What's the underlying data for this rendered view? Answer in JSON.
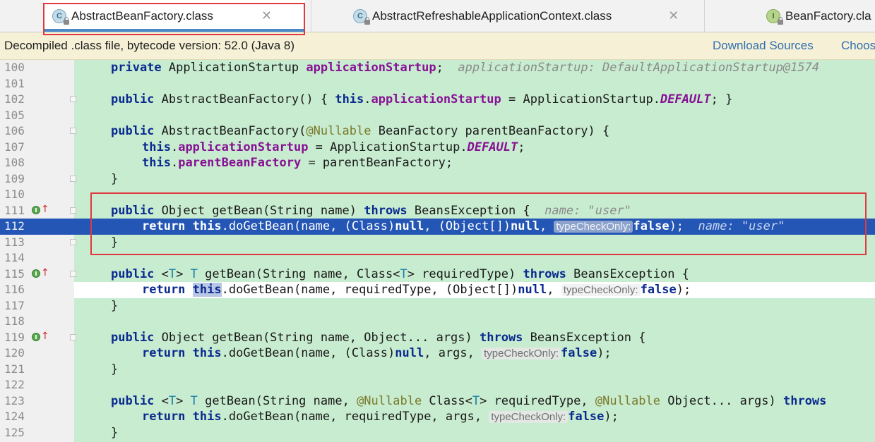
{
  "tabs": [
    {
      "icon": "C",
      "label": "AbstractBeanFactory.class",
      "close": "✕"
    },
    {
      "icon": "C",
      "label": "AbstractRefreshableApplicationContext.class",
      "close": "✕"
    },
    {
      "icon": "I",
      "label": "BeanFactory.cla"
    }
  ],
  "banner": {
    "text": "Decompiled .class file, bytecode version: 52.0 (Java 8)",
    "download_sources": "Download Sources",
    "choose": "Choos"
  },
  "lines": {
    "l100": "100",
    "l101": "101",
    "l102": "102",
    "l105": "105",
    "l106": "106",
    "l107": "107",
    "l108": "108",
    "l109": "109",
    "l110": "110",
    "l111": "111",
    "l112": "112",
    "l113": "113",
    "l114": "114",
    "l115": "115",
    "l116": "116",
    "l117": "117",
    "l118": "118",
    "l119": "119",
    "l120": "120",
    "l121": "121",
    "l122": "122",
    "l123": "123",
    "l124": "124",
    "l125": "125"
  },
  "code": {
    "private": "private",
    "public": "public",
    "return": "return",
    "this": "this",
    "throws": "throws",
    "null": "null",
    "false": "false",
    "nullable": "@Nullable",
    "ApplicationStartup": "ApplicationStartup",
    "applicationStartup": "applicationStartup",
    "semi": ";",
    "hint100": "applicationStartup: DefaultApplicationStartup@1574",
    "ctor102": "AbstractBeanFactory() ",
    "ctor102b": "{ ",
    "eq": " = ",
    "appStartupDefault": "ApplicationStartup.",
    "DEFAULT": "DEFAULT",
    "ctor102end": "; }",
    "ctor106": "AbstractBeanFactory(",
    "ctor106b": " BeanFactory parentBeanFactory) {",
    "dot": ".",
    "parentBeanFactory": "parentBeanFactory",
    "parentAssign": " = parentBeanFactory;",
    "brace": "}",
    "sig111": " Object getBean(String name) ",
    "sig111b": " BeansException {",
    "hint_name": "name: \"user\"",
    "body112a": ".doGetBean(name, (Class)",
    "body112b": ", (Object[])",
    "body112c": ", ",
    "chip": "typeCheckOnly:",
    "end112": ");",
    "sig115a": " <",
    "T": "T",
    "sig115b": "> ",
    "sig115c": " getBean(String name, Class<",
    "sig115d": "> requiredType) ",
    "sig115e": " BeansException {",
    "body116a": ".doGetBean(name, requiredType, (Object[])",
    "body116b": ", ",
    "sig119": " Object getBean(String name, Object... args) ",
    "sig119b": " BeansException {",
    "body120a": ".doGetBean(name, (Class)",
    "body120b": ", args, ",
    "sig123c": " getBean(String name, ",
    "sig123d": " Class<",
    "sig123e": "> requiredType, ",
    "sig123f": " Object... args) ",
    "throwsTrunc": "throws",
    "body124a": ".doGetBean(name, requiredType, args, "
  },
  "colors": {
    "selection": "#2456b5",
    "editor_bg": "#c8ecd0",
    "highlight_box": "#e0393e",
    "link": "#2f6fb3"
  }
}
